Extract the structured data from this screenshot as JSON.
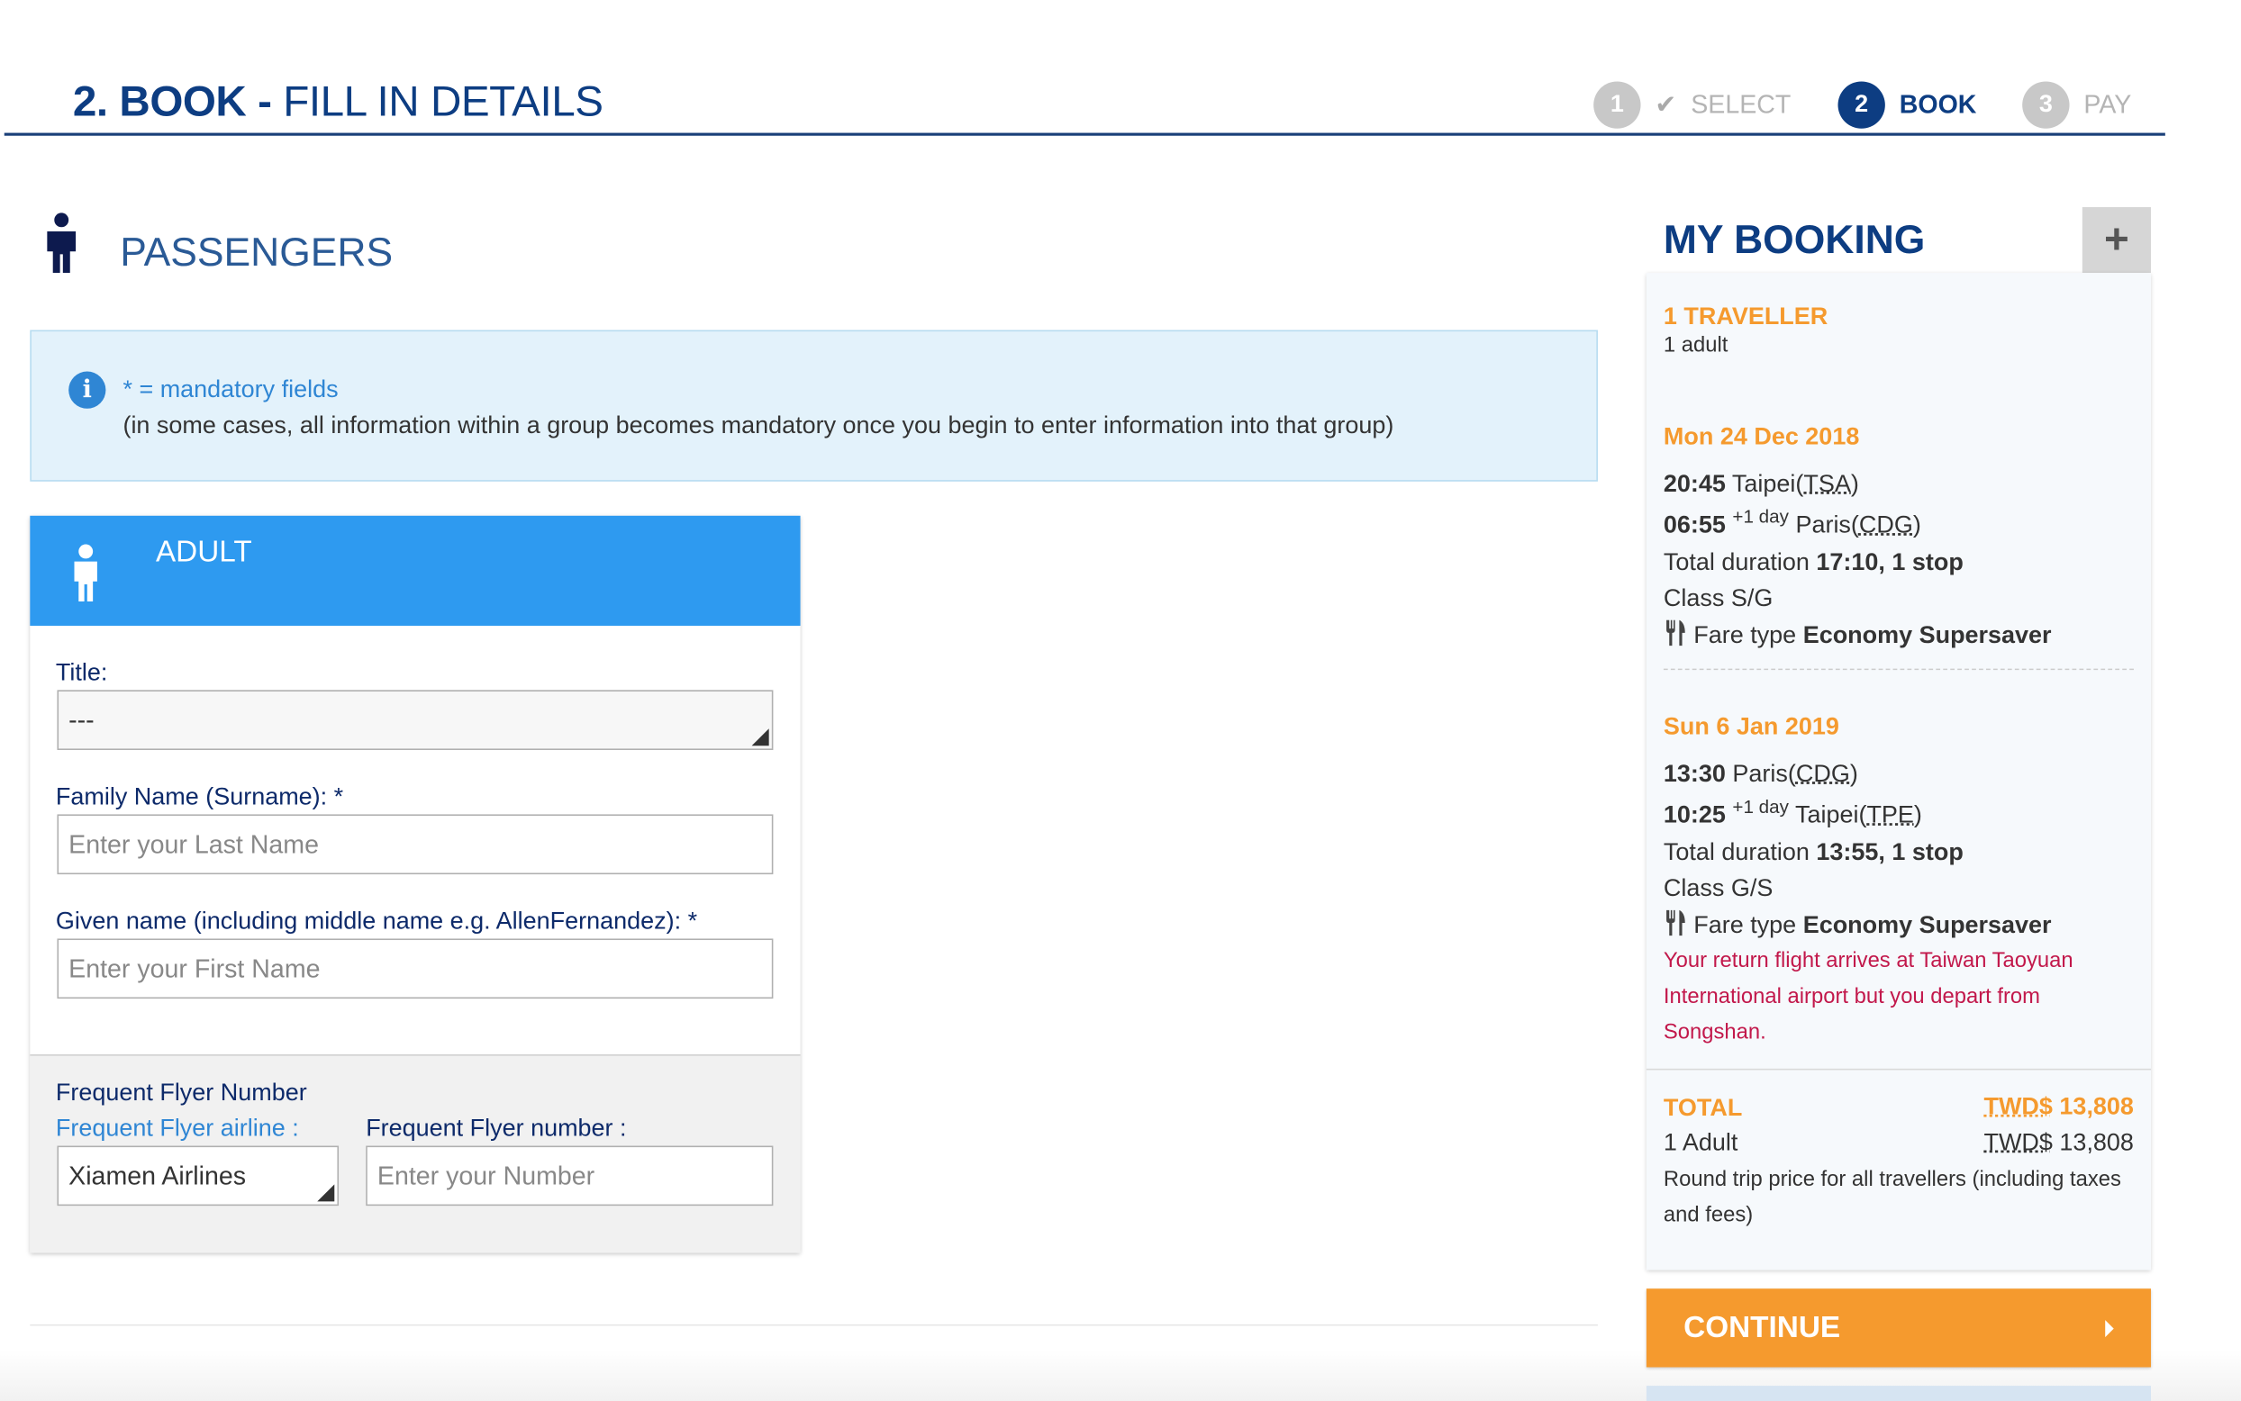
{
  "header": {
    "title_bold": "2. BOOK -",
    "title_rest": "FILL IN DETAILS",
    "steps": [
      {
        "number": "1",
        "label": "SELECT",
        "state": "done"
      },
      {
        "number": "2",
        "label": "BOOK",
        "state": "active"
      },
      {
        "number": "3",
        "label": "PAY",
        "state": "pending"
      }
    ]
  },
  "passengers": {
    "title": "PASSENGERS",
    "info": {
      "line1": "* = mandatory fields",
      "line2": "(in some cases, all information within a group becomes mandatory once you begin to enter information into that group)"
    },
    "adult": {
      "title": "ADULT",
      "title_label": "Title:",
      "title_value": "---",
      "family_label": "Family Name (Surname): *",
      "family_placeholder": "Enter your Last Name",
      "given_label": "Given name (including middle name e.g. AllenFernandez): *",
      "given_placeholder": "Enter your First Name",
      "ff_heading": "Frequent Flyer Number",
      "ff_airline_label": "Frequent Flyer airline :",
      "ff_airline_value": "Xiamen Airlines",
      "ff_number_label": "Frequent Flyer number :",
      "ff_number_placeholder": "Enter your Number"
    }
  },
  "booking": {
    "title": "MY BOOKING",
    "expand_symbol": "+",
    "travellers": "1 TRAVELLER",
    "travellers_sub": "1 adult",
    "outbound": {
      "date": "Mon 24 Dec 2018",
      "dep_time": "20:45",
      "dep_city": "Taipei(",
      "dep_code": "TSA",
      "arr_time": "06:55",
      "arr_plus": "+1 day",
      "arr_city": "Paris(",
      "arr_code": "CDG",
      "duration_label": "Total duration",
      "duration_value": "17:10, 1 stop",
      "class_text": "Class S/G",
      "fare_label": "Fare type",
      "fare_value": "Economy Supersaver"
    },
    "return": {
      "date": "Sun 6 Jan 2019",
      "dep_time": "13:30",
      "dep_city": "Paris(",
      "dep_code": "CDG",
      "arr_time": "10:25",
      "arr_plus": "+1 day",
      "arr_city": "Taipei(",
      "arr_code": "TPE",
      "duration_label": "Total duration",
      "duration_value": "13:55, 1 stop",
      "class_text": "Class G/S",
      "fare_label": "Fare type",
      "fare_value": "Economy Supersaver",
      "warning_l1": "Your return flight arrives at Taiwan Taoyuan",
      "warning_l2": "International airport but you depart from",
      "warning_l3": "Songshan."
    },
    "total": {
      "label": "TOTAL",
      "currency": "TWD$",
      "amount": "13,808",
      "adult_label": "1 Adult",
      "adult_currency": "TWD$",
      "adult_amount": "13,808",
      "note_l1": "Round trip price for all travellers (including taxes",
      "note_l2": "and fees)"
    },
    "continue_label": "CONTINUE"
  },
  "colors": {
    "navy": "#0d3d82",
    "header_blue": "#2e9af0",
    "orange": "#f59a2e",
    "warning_red": "#c2184b"
  }
}
